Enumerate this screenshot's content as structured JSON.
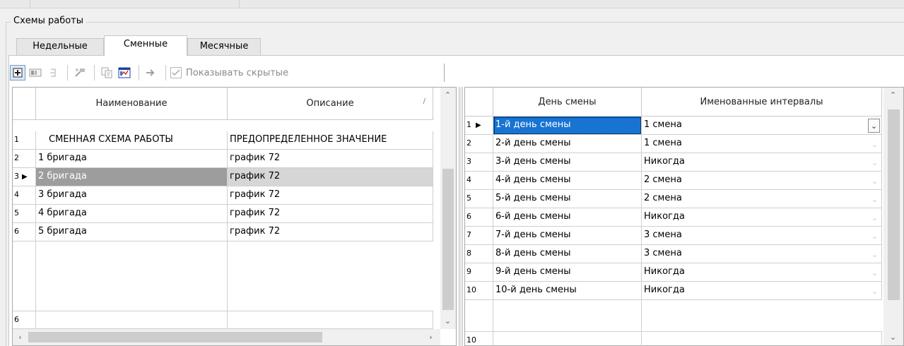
{
  "group_title": "Схемы работы",
  "tabs": [
    {
      "label": "Недельные"
    },
    {
      "label": "Сменные"
    },
    {
      "label": "Месячные"
    }
  ],
  "toolbar": {
    "show_hidden_label": "Показывать скрытые"
  },
  "left_grid": {
    "columns": [
      "Наименование",
      "Описание"
    ],
    "sort_marker": "/",
    "rows": [
      {
        "num": "1",
        "name": "СМЕННАЯ СХЕМА РАБОТЫ",
        "desc": "ПРЕДОПРЕДЕЛЕННОЕ ЗНАЧЕНИЕ"
      },
      {
        "num": "2",
        "name": "1 бригада",
        "desc": "график 72"
      },
      {
        "num": "3",
        "name": "2 бригада",
        "desc": "график 72"
      },
      {
        "num": "4",
        "name": "3 бригада",
        "desc": "график 72"
      },
      {
        "num": "5",
        "name": "4 бригада",
        "desc": "график 72"
      },
      {
        "num": "6",
        "name": "5 бригада",
        "desc": "график 72"
      }
    ],
    "selected_row": 3,
    "footer_count": "6"
  },
  "right_grid": {
    "columns": [
      "День смены",
      "Именованные интервалы"
    ],
    "rows": [
      {
        "num": "1",
        "day": "1-й день смены",
        "interval": "1 смена"
      },
      {
        "num": "2",
        "day": "2-й день смены",
        "interval": "1 смена"
      },
      {
        "num": "3",
        "day": "3-й день смены",
        "interval": "Никогда"
      },
      {
        "num": "4",
        "day": "4-й день смены",
        "interval": "2 смена"
      },
      {
        "num": "5",
        "day": "5-й день смены",
        "interval": "2 смена"
      },
      {
        "num": "6",
        "day": "6-й день смены",
        "interval": "Никогда"
      },
      {
        "num": "7",
        "day": "7-й день смены",
        "interval": "3 смена"
      },
      {
        "num": "8",
        "day": "8-й день смены",
        "interval": "3 смена"
      },
      {
        "num": "9",
        "day": "9-й день смены",
        "interval": "Никогда"
      },
      {
        "num": "10",
        "day": "10-й день смены",
        "interval": "Никогда"
      }
    ],
    "selected_row": 1,
    "footer_count": "10"
  },
  "colors": {
    "selection_blue": "#1874d2",
    "selection_gray": "#9d9d9d"
  }
}
